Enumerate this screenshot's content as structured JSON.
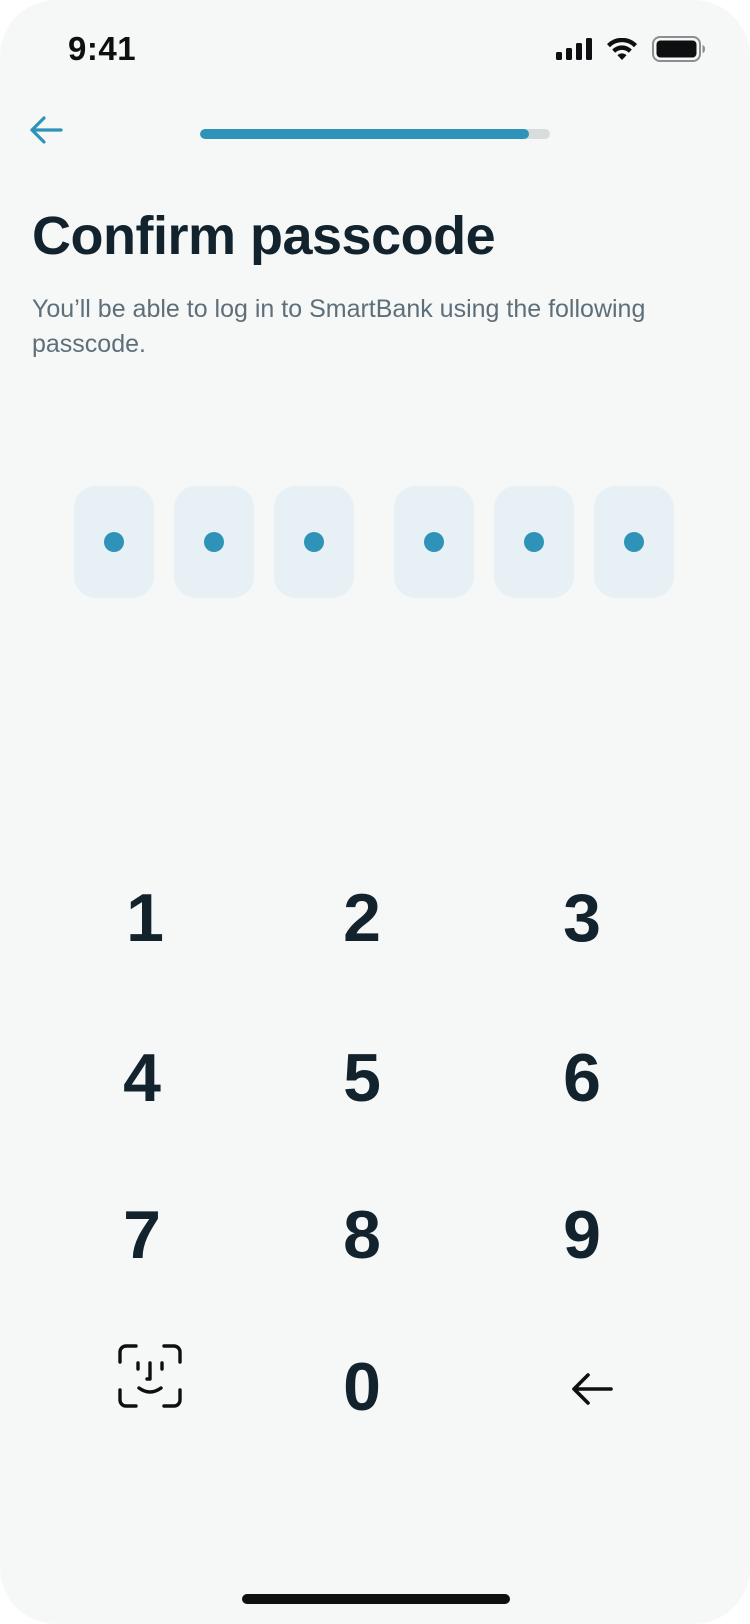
{
  "status_bar": {
    "time": "9:41"
  },
  "header": {
    "back_icon": "arrow-left-icon",
    "progress": 0.94
  },
  "content": {
    "title": "Confirm passcode",
    "subtitle": "You’ll be able to log in to SmartBank using the following passcode."
  },
  "passcode": {
    "length": 6,
    "filled": 6
  },
  "keypad": {
    "keys": {
      "k1": "1",
      "k2": "2",
      "k3": "3",
      "k4": "4",
      "k5": "5",
      "k6": "6",
      "k7": "7",
      "k8": "8",
      "k9": "9",
      "k0": "0"
    },
    "biometric_icon": "face-id-icon",
    "delete_icon": "arrow-left-icon"
  },
  "colors": {
    "accent": "#2f93b9",
    "text_primary": "#13232e",
    "text_secondary": "#5e6f7a",
    "box_background": "#e6f0f5",
    "screen_background": "#f6f8f8"
  }
}
